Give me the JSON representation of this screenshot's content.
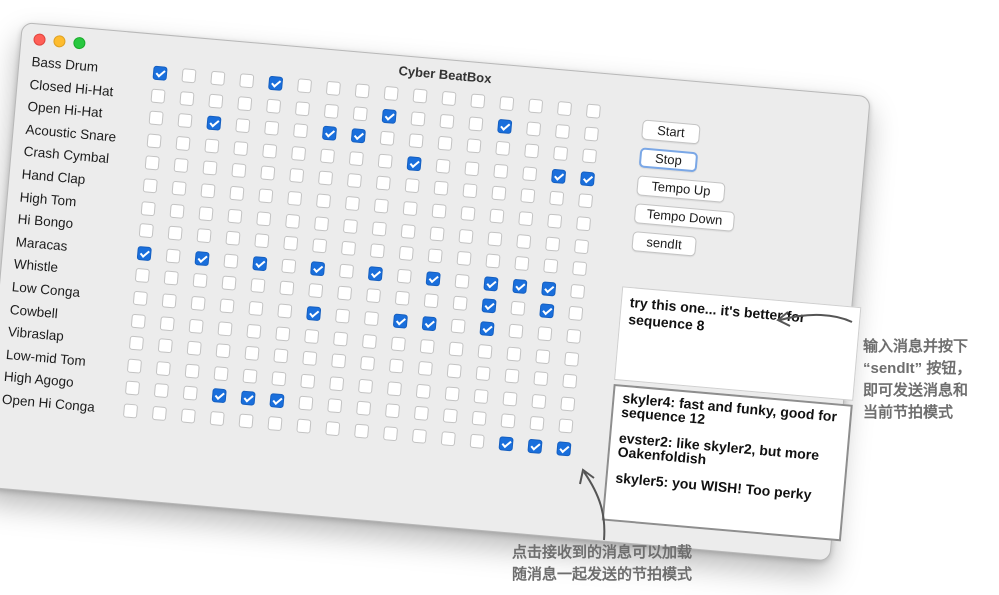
{
  "window": {
    "title": "Cyber BeatBox"
  },
  "instruments": [
    "Bass Drum",
    "Closed Hi-Hat",
    "Open Hi-Hat",
    "Acoustic Snare",
    "Crash Cymbal",
    "Hand Clap",
    "High Tom",
    "Hi Bongo",
    "Maracas",
    "Whistle",
    "Low Conga",
    "Cowbell",
    "Vibraslap",
    "Low-mid Tom",
    "High Agogo",
    "Open Hi Conga"
  ],
  "grid": {
    "beats": 16,
    "checked": [
      [
        1,
        0,
        0,
        0,
        1,
        0,
        0,
        0,
        0,
        0,
        0,
        0,
        0,
        0,
        0,
        0
      ],
      [
        0,
        0,
        0,
        0,
        0,
        0,
        0,
        0,
        1,
        0,
        0,
        0,
        1,
        0,
        0,
        0
      ],
      [
        0,
        0,
        1,
        0,
        0,
        0,
        1,
        1,
        0,
        0,
        0,
        0,
        0,
        0,
        0,
        0
      ],
      [
        0,
        0,
        0,
        0,
        0,
        0,
        0,
        0,
        0,
        1,
        0,
        0,
        0,
        0,
        1,
        1
      ],
      [
        0,
        0,
        0,
        0,
        0,
        0,
        0,
        0,
        0,
        0,
        0,
        0,
        0,
        0,
        0,
        0
      ],
      [
        0,
        0,
        0,
        0,
        0,
        0,
        0,
        0,
        0,
        0,
        0,
        0,
        0,
        0,
        0,
        0
      ],
      [
        0,
        0,
        0,
        0,
        0,
        0,
        0,
        0,
        0,
        0,
        0,
        0,
        0,
        0,
        0,
        0
      ],
      [
        0,
        0,
        0,
        0,
        0,
        0,
        0,
        0,
        0,
        0,
        0,
        0,
        0,
        0,
        0,
        0
      ],
      [
        1,
        0,
        1,
        0,
        1,
        0,
        1,
        0,
        1,
        0,
        1,
        0,
        1,
        1,
        1,
        0
      ],
      [
        0,
        0,
        0,
        0,
        0,
        0,
        0,
        0,
        0,
        0,
        0,
        0,
        1,
        0,
        1,
        0
      ],
      [
        0,
        0,
        0,
        0,
        0,
        0,
        1,
        0,
        0,
        1,
        1,
        0,
        1,
        0,
        0,
        0
      ],
      [
        0,
        0,
        0,
        0,
        0,
        0,
        0,
        0,
        0,
        0,
        0,
        0,
        0,
        0,
        0,
        0
      ],
      [
        0,
        0,
        0,
        0,
        0,
        0,
        0,
        0,
        0,
        0,
        0,
        0,
        0,
        0,
        0,
        0
      ],
      [
        0,
        0,
        0,
        0,
        0,
        0,
        0,
        0,
        0,
        0,
        0,
        0,
        0,
        0,
        0,
        0
      ],
      [
        0,
        0,
        0,
        1,
        1,
        1,
        0,
        0,
        0,
        0,
        0,
        0,
        0,
        0,
        0,
        0
      ],
      [
        0,
        0,
        0,
        0,
        0,
        0,
        0,
        0,
        0,
        0,
        0,
        0,
        0,
        1,
        1,
        1
      ]
    ]
  },
  "buttons": {
    "start": "Start",
    "stop": "Stop",
    "tempo_up": "Tempo Up",
    "tempo_down": "Tempo Down",
    "send": "sendIt"
  },
  "message_input": "try this one... it's better for sequence 8",
  "incoming_messages": [
    "skyler4: fast and funky, good for sequence 12",
    "evster2: like skyler2, but more Oakenfoldish",
    "skyler5: you WISH! Too perky"
  ],
  "annotations": {
    "right_lines": [
      "输入消息并按下",
      "“sendIt” 按钮，",
      "即可发送消息和",
      "当前节拍模式"
    ],
    "bottom_lines": [
      "点击接收到的消息可以加载",
      "随消息一起发送的节拍模式"
    ]
  },
  "colors": {
    "check_blue": "#1a6fdc",
    "annotation_gray": "#6e6e6e",
    "window_bg": "#ececec"
  }
}
